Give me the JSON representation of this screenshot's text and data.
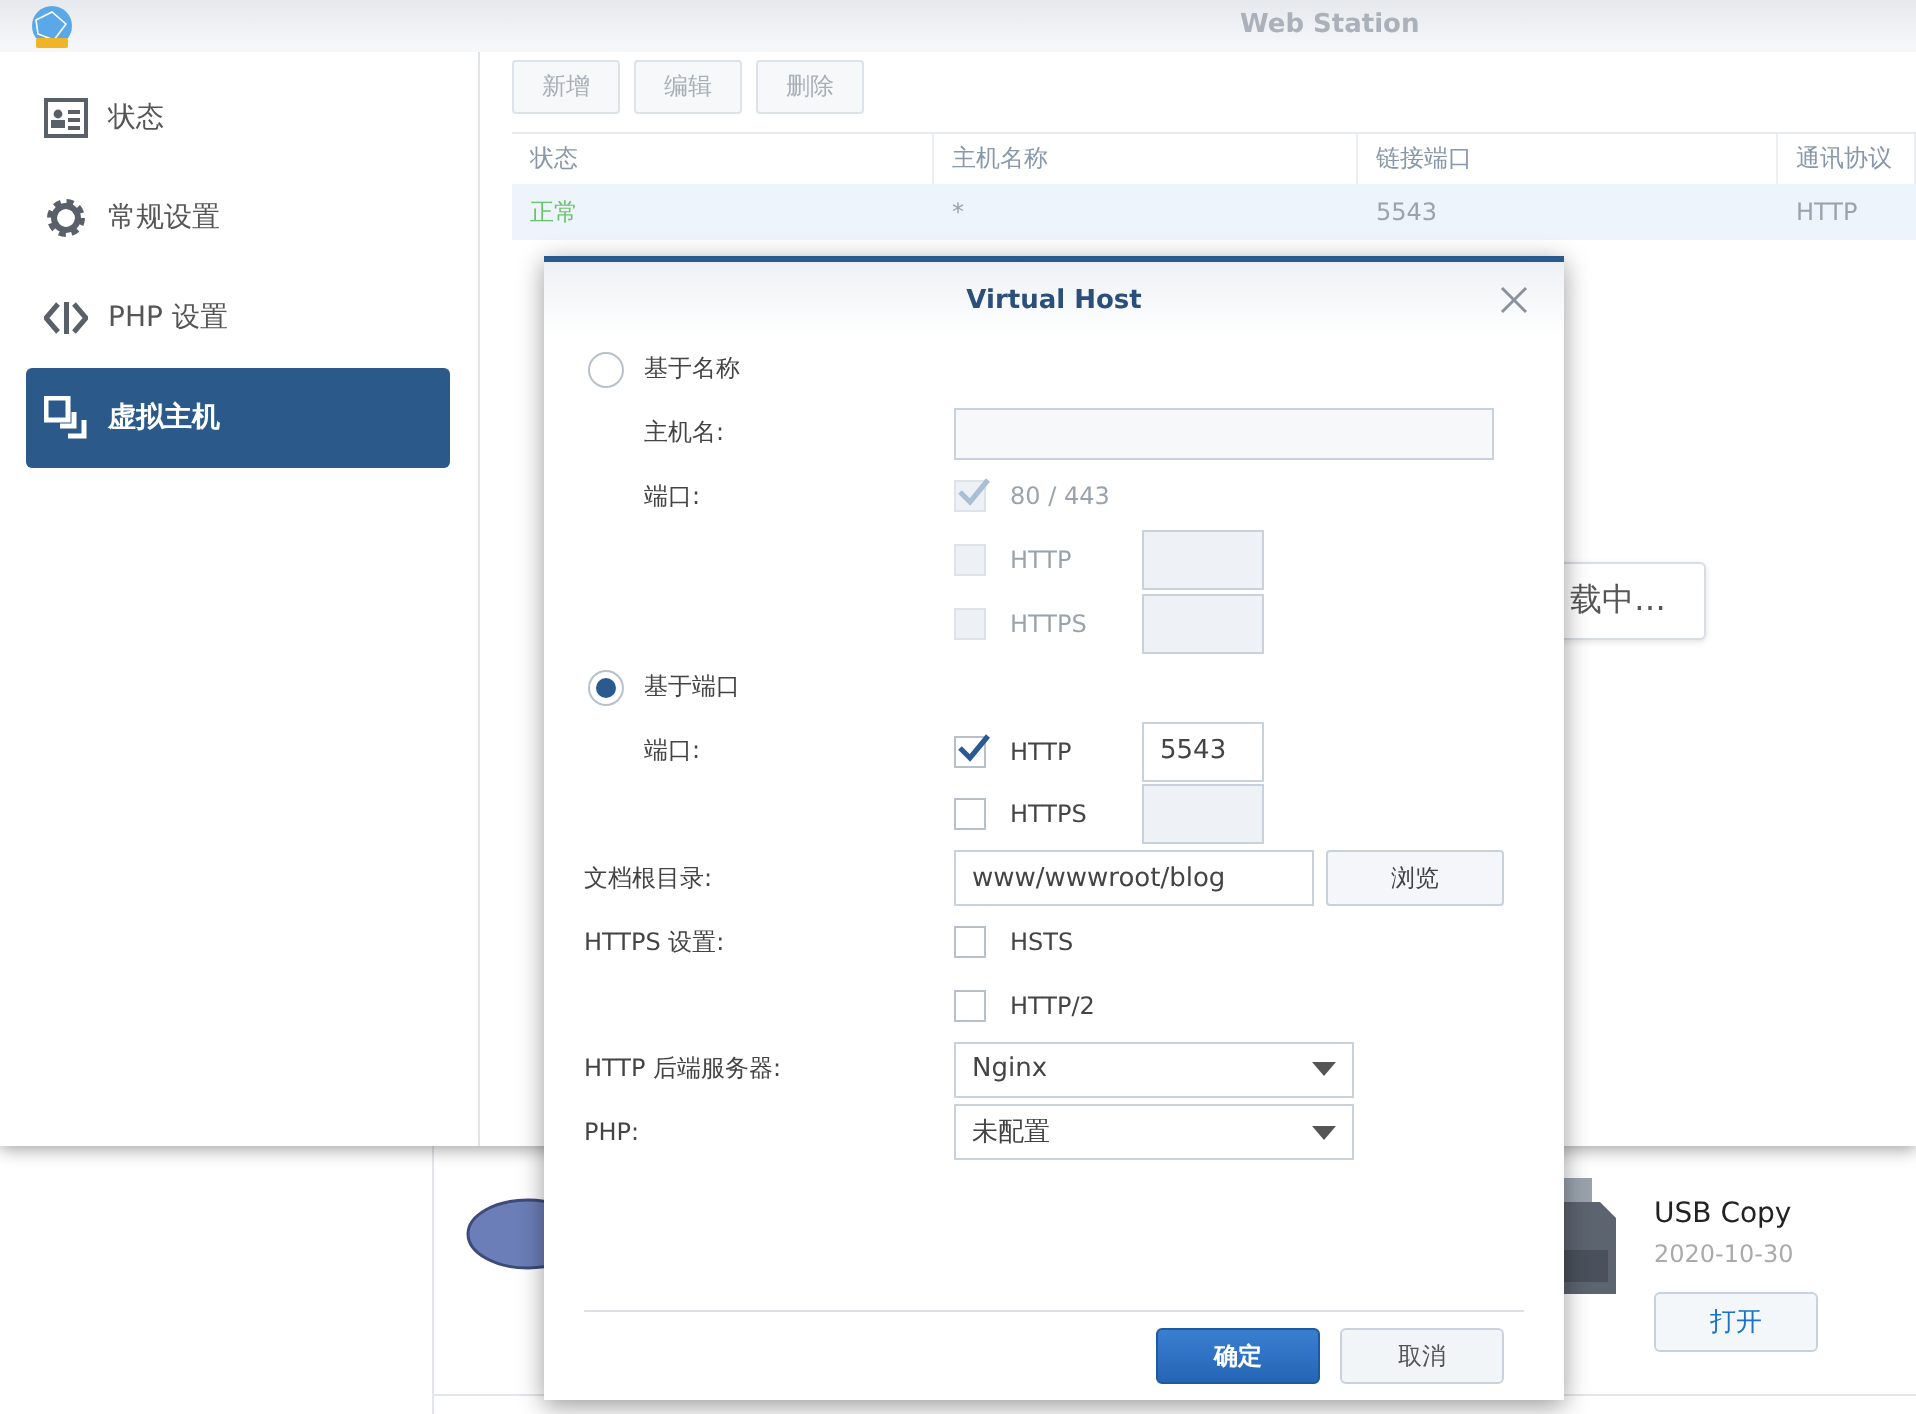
{
  "window": {
    "title": "Web Station"
  },
  "sidebar": {
    "items": [
      {
        "label": "状态",
        "kind": "status",
        "selected": false
      },
      {
        "label": "常规设置",
        "kind": "general",
        "selected": false
      },
      {
        "label": "PHP 设置",
        "kind": "php",
        "selected": false
      },
      {
        "label": "虚拟主机",
        "kind": "hosts",
        "selected": true
      }
    ]
  },
  "toolbar": {
    "buttons": [
      {
        "label": "新增",
        "disabled": true
      },
      {
        "label": "编辑",
        "disabled": true
      },
      {
        "label": "删除",
        "disabled": true
      }
    ]
  },
  "table": {
    "columns": [
      "状态",
      "主机名称",
      "链接端口",
      "通讯协议"
    ],
    "rows": [
      {
        "color": "#6cc36c",
        "cells": [
          "正常",
          "*",
          "5543",
          "HTTP"
        ],
        "selected": true
      }
    ]
  },
  "loading_popup": {
    "text": "载中…"
  },
  "background_app": {
    "name": "USB Copy",
    "date": "2020-10-30",
    "button": "打开"
  },
  "dialog": {
    "title": "Virtual Host",
    "rows": [
      {
        "kind": "radio",
        "label": "基于名称",
        "selected": false,
        "children": [
          {
            "kind": "text",
            "label": "主机名:"
          },
          {
            "kind": "check",
            "label": "端口:",
            "text": "80 / 443",
            "checked": true,
            "disabled": true
          },
          {
            "kind": "check",
            "text": "HTTP",
            "checked": false,
            "disabled": true,
            "port": {
              "disabled": true
            }
          },
          {
            "kind": "check",
            "text": "HTTPS",
            "checked": false,
            "disabled": true,
            "port": {
              "disabled": true
            }
          }
        ]
      },
      {
        "kind": "radio",
        "label": "基于端口",
        "selected": true,
        "children": [
          {
            "kind": "check",
            "label": "端口:",
            "text": "HTTP",
            "checked": true,
            "disabled": false,
            "port": {
              "value": "5543",
              "disabled": false
            }
          },
          {
            "kind": "check",
            "text": "HTTPS",
            "checked": false,
            "disabled": false,
            "port": {
              "disabled": true
            }
          }
        ]
      },
      {
        "kind": "path",
        "label": "文档根目录:",
        "value": "www/wwwroot/blog",
        "button": "浏览"
      },
      {
        "kind": "check",
        "label": "HTTPS 设置:",
        "text": "HSTS",
        "checked": false,
        "disabled": false
      },
      {
        "kind": "check",
        "text": "HTTP/2",
        "checked": false,
        "disabled": false
      },
      {
        "kind": "select",
        "label": "HTTP 后端服务器:",
        "value": "Nginx"
      },
      {
        "kind": "select",
        "label": "PHP:",
        "value": "未配置"
      }
    ],
    "buttons": [
      {
        "label": "确定",
        "kind": "primary"
      },
      {
        "label": "取消",
        "kind": "secondary"
      }
    ]
  }
}
